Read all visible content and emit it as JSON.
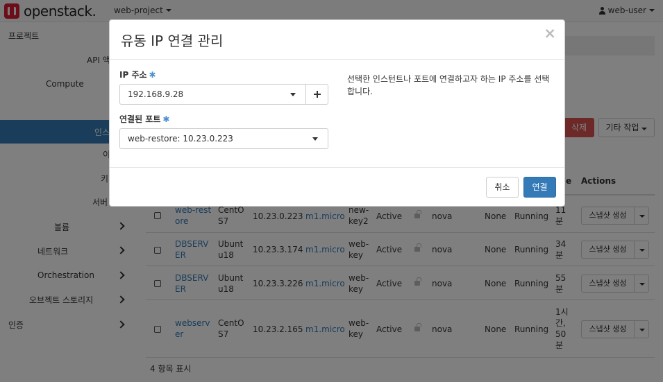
{
  "app": {
    "brand": "openstack."
  },
  "topbar": {
    "project": "web-project",
    "user": "web-user"
  },
  "sidebar": {
    "project": "프로젝트",
    "api": "API 액세스",
    "compute": "Compute",
    "instances": "인스턴스",
    "images": "이미지",
    "keypairs": "키 페어",
    "server_groups": "서버 그룹",
    "volumes": "볼륨",
    "network": "네트워크",
    "orchestration": "Orchestration",
    "object_storage": "오브젝트 스토리지",
    "identity": "인증"
  },
  "toolbar": {
    "delete": "삭제",
    "more_actions": "기타 작업"
  },
  "table": {
    "header_partial": "e",
    "header_actions": "Actions",
    "rows": [
      {
        "name_l1": "web-rest",
        "name_l2": "ore",
        "image_l1": "CentO",
        "image_l2": "S7",
        "ip": "10.23.0.223",
        "flavor": "m1.micro",
        "key_l1": "new-",
        "key_l2": "key2",
        "status": "Active",
        "zone": "nova",
        "task": "None",
        "power": "Running",
        "age_l1": "11",
        "age_l2": "분",
        "age_l3": "",
        "age_l4": "",
        "action": "스냅샷 생성"
      },
      {
        "name_l1": "DBSERV",
        "name_l2": "ER",
        "image_l1": "Ubunt",
        "image_l2": "u18",
        "ip": "10.23.3.174",
        "flavor": "m1.micro",
        "key_l1": "web-",
        "key_l2": "key",
        "status": "Active",
        "zone": "nova",
        "task": "None",
        "power": "Running",
        "age_l1": "34",
        "age_l2": "분",
        "age_l3": "",
        "age_l4": "",
        "action": "스냅샷 생성"
      },
      {
        "name_l1": "DBSERV",
        "name_l2": "ER",
        "image_l1": "Ubunt",
        "image_l2": "u18",
        "ip": "10.23.3.226",
        "flavor": "m1.micro",
        "key_l1": "web-",
        "key_l2": "key",
        "status": "Active",
        "zone": "nova",
        "task": "None",
        "power": "Running",
        "age_l1": "55",
        "age_l2": "분",
        "age_l3": "",
        "age_l4": "",
        "action": "스냅샷 생성"
      },
      {
        "name_l1": "webserv",
        "name_l2": "er",
        "image_l1": "CentO",
        "image_l2": "S7",
        "ip": "10.23.2.165",
        "flavor": "m1.micro",
        "key_l1": "web-",
        "key_l2": "key",
        "status": "Active",
        "zone": "nova",
        "task": "None",
        "power": "Running",
        "age_l1": "1시",
        "age_l2": "간,",
        "age_l3": "50",
        "age_l4": "분",
        "action": "스냅샷 생성"
      }
    ],
    "footer": "4 항목 표시"
  },
  "modal": {
    "title": "유동 IP 연결 관리",
    "close": "×",
    "ip_label": "IP 주소",
    "ip_value": "192.168.9.28",
    "port_label": "연결된 포트",
    "port_value": "web-restore: 10.23.0.223",
    "required_mark": "✱",
    "help_text": "선택한 인스턴트나 포트에 연결하고자 하는 IP 주소를 선택합니다.",
    "cancel": "취소",
    "connect": "연결"
  },
  "colors": {
    "primary": "#337ab7",
    "danger": "#d9534f",
    "brand": "#da1a32"
  }
}
